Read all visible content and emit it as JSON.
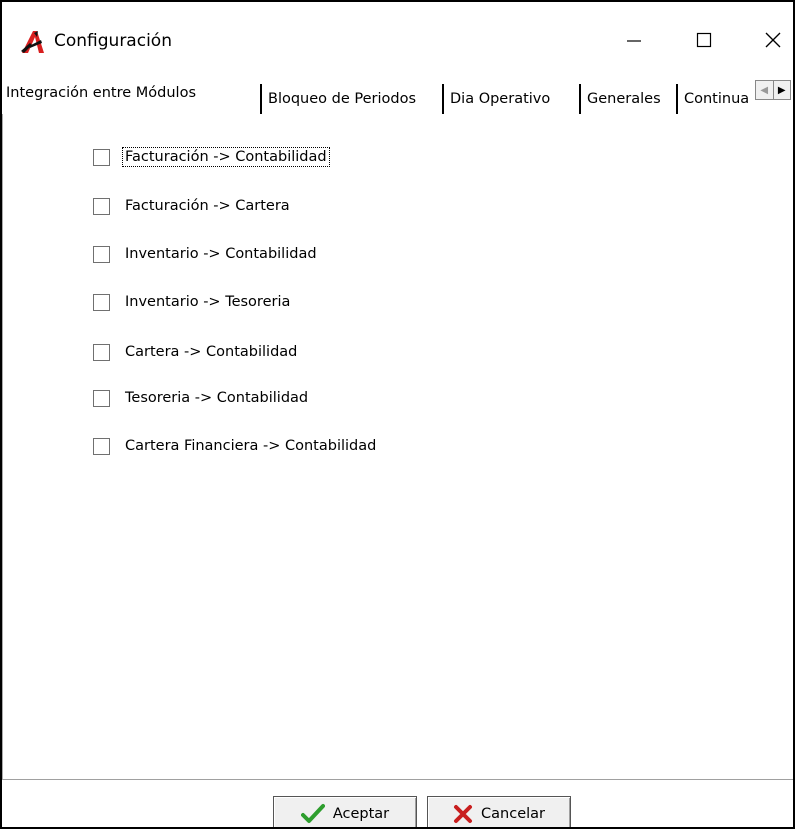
{
  "window": {
    "title": "Configuración",
    "controls": {
      "minimize_glyph": "—",
      "maximize_glyph": "☐",
      "close_glyph": "✕"
    }
  },
  "tabs": [
    {
      "label": "Integración entre Módulos",
      "active": true
    },
    {
      "label": "Bloqueo de Periodos",
      "active": false
    },
    {
      "label": "Dia Operativo",
      "active": false
    },
    {
      "label": "Generales",
      "active": false
    },
    {
      "label": "Continua",
      "active": false
    }
  ],
  "tab_scroll": {
    "left_glyph": "◀",
    "right_glyph": "▶"
  },
  "checkboxes": [
    {
      "label": "Facturación -> Contabilidad",
      "checked": false,
      "focused": true
    },
    {
      "label": "Facturación -> Cartera",
      "checked": false
    },
    {
      "label": "Inventario -> Contabilidad",
      "checked": false
    },
    {
      "label": "Inventario -> Tesoreria",
      "checked": false
    },
    {
      "label": "Cartera -> Contabilidad",
      "checked": false
    },
    {
      "label": "Tesoreria -> Contabilidad",
      "checked": false
    },
    {
      "label": "Cartera Financiera -> Contabilidad",
      "checked": false
    }
  ],
  "buttons": {
    "accept_label": "Aceptar",
    "cancel_label": "Cancelar"
  },
  "colors": {
    "accept_check": "#2e9e2e",
    "cancel_x": "#c81e1e",
    "icon_red": "#d81f1f",
    "icon_black": "#111111"
  },
  "icons": {
    "app": "stylized-a-logo-icon",
    "accept": "checkmark-icon",
    "cancel": "x-icon"
  }
}
